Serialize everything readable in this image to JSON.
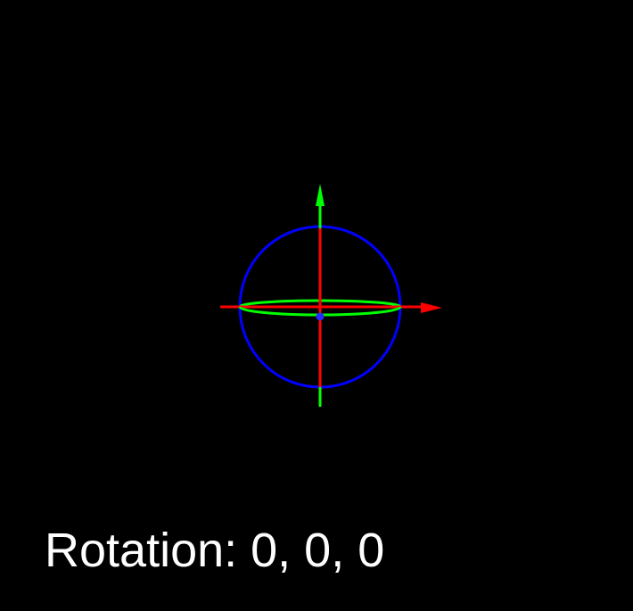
{
  "scene": {
    "background_color": "#000000",
    "rotation": {
      "x": 0,
      "y": 0,
      "z": 0
    },
    "gizmo": {
      "x_axis_color": "#ff0000",
      "y_axis_color": "#00ff00",
      "z_ring_color": "#0000ff",
      "equator_ring_color": "#00ff00",
      "pivot_color": "#2a2aff"
    }
  },
  "readout": {
    "label": "Rotation: 0, 0, 0"
  }
}
